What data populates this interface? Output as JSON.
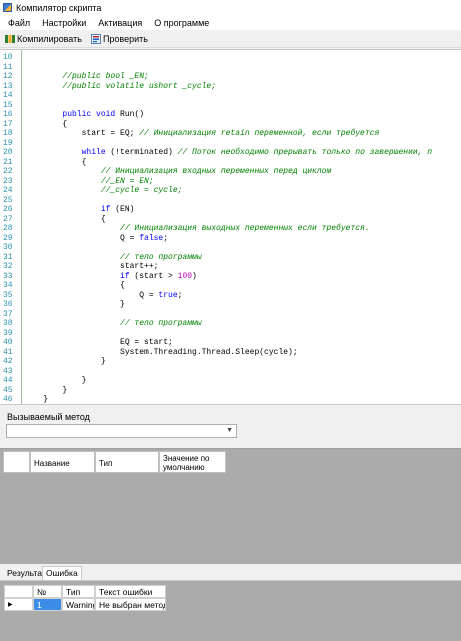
{
  "window": {
    "title": "Компилятор скрипта"
  },
  "menu": [
    "Файл",
    "Настройки",
    "Активация",
    "О программе"
  ],
  "toolbar": {
    "compile_label": "Компилировать",
    "check_label": "Проверить"
  },
  "code_lines": [
    {
      "n": "10",
      "segs": []
    },
    {
      "n": "11",
      "segs": []
    },
    {
      "n": "12",
      "segs": [
        {
          "t": "        "
        },
        {
          "t": "//public bool _EN;",
          "c": "cmt"
        }
      ]
    },
    {
      "n": "13",
      "segs": [
        {
          "t": "        "
        },
        {
          "t": "//public volatile ushort _cycle;",
          "c": "cmt"
        }
      ]
    },
    {
      "n": "14",
      "segs": []
    },
    {
      "n": "15",
      "segs": []
    },
    {
      "n": "16",
      "segs": [
        {
          "t": "        "
        },
        {
          "t": "public",
          "c": "kw"
        },
        {
          "t": " "
        },
        {
          "t": "void",
          "c": "kw"
        },
        {
          "t": " Run()"
        }
      ]
    },
    {
      "n": "17",
      "segs": [
        {
          "t": "        {"
        }
      ]
    },
    {
      "n": "18",
      "segs": [
        {
          "t": "            start = EQ; "
        },
        {
          "t": "// Инициализация retain переменной, если требуется",
          "c": "cmt"
        }
      ]
    },
    {
      "n": "19",
      "segs": []
    },
    {
      "n": "20",
      "segs": [
        {
          "t": "            "
        },
        {
          "t": "while",
          "c": "kw"
        },
        {
          "t": " (!terminated) "
        },
        {
          "t": "// Поток необходимо прерывать только по завершении, п",
          "c": "cmt"
        }
      ]
    },
    {
      "n": "21",
      "segs": [
        {
          "t": "            {"
        }
      ]
    },
    {
      "n": "22",
      "segs": [
        {
          "t": "                "
        },
        {
          "t": "// Инициализация входных переменных перед циклом",
          "c": "cmt"
        }
      ]
    },
    {
      "n": "23",
      "segs": [
        {
          "t": "                "
        },
        {
          "t": "//_EN = EN;",
          "c": "cmt"
        }
      ]
    },
    {
      "n": "24",
      "segs": [
        {
          "t": "                "
        },
        {
          "t": "//_cycle = cycle;",
          "c": "cmt"
        }
      ]
    },
    {
      "n": "25",
      "segs": []
    },
    {
      "n": "26",
      "segs": [
        {
          "t": "                "
        },
        {
          "t": "if",
          "c": "kw"
        },
        {
          "t": " (EN)"
        }
      ]
    },
    {
      "n": "27",
      "segs": [
        {
          "t": "                {"
        }
      ]
    },
    {
      "n": "28",
      "segs": [
        {
          "t": "                    "
        },
        {
          "t": "// Инициализация выходных переменных если требуется.",
          "c": "cmt"
        }
      ]
    },
    {
      "n": "29",
      "segs": [
        {
          "t": "                    Q = "
        },
        {
          "t": "false",
          "c": "kw"
        },
        {
          "t": ";"
        }
      ]
    },
    {
      "n": "30",
      "segs": []
    },
    {
      "n": "31",
      "segs": [
        {
          "t": "                    "
        },
        {
          "t": "// тело программы",
          "c": "cmt"
        }
      ]
    },
    {
      "n": "32",
      "segs": [
        {
          "t": "                    start++;"
        }
      ]
    },
    {
      "n": "33",
      "segs": [
        {
          "t": "                    "
        },
        {
          "t": "if",
          "c": "kw"
        },
        {
          "t": " (start > "
        },
        {
          "t": "100",
          "c": "num"
        },
        {
          "t": ")"
        }
      ]
    },
    {
      "n": "34",
      "segs": [
        {
          "t": "                    {"
        }
      ]
    },
    {
      "n": "35",
      "segs": [
        {
          "t": "                        Q = "
        },
        {
          "t": "true",
          "c": "kw"
        },
        {
          "t": ";"
        }
      ]
    },
    {
      "n": "36",
      "segs": [
        {
          "t": "                    }"
        }
      ]
    },
    {
      "n": "37",
      "segs": []
    },
    {
      "n": "38",
      "segs": [
        {
          "t": "                    "
        },
        {
          "t": "// тело программы",
          "c": "cmt"
        }
      ]
    },
    {
      "n": "39",
      "segs": []
    },
    {
      "n": "40",
      "segs": [
        {
          "t": "                    EQ = start;"
        }
      ]
    },
    {
      "n": "41",
      "segs": [
        {
          "t": "                    System.Threading.Thread.Sleep(cycle);"
        }
      ]
    },
    {
      "n": "42",
      "segs": [
        {
          "t": "                }"
        }
      ]
    },
    {
      "n": "43",
      "segs": []
    },
    {
      "n": "44",
      "segs": [
        {
          "t": "            }"
        }
      ]
    },
    {
      "n": "45",
      "segs": [
        {
          "t": "        }"
        }
      ]
    },
    {
      "n": "46",
      "segs": [
        {
          "t": "    }"
        }
      ]
    }
  ],
  "method": {
    "label": "Вызываемый метод",
    "value": ""
  },
  "params_table": {
    "columns": [
      "Название",
      "Тип",
      "Значение по умолчанию"
    ]
  },
  "bottom_tabs": [
    "Результат",
    "Ошибка"
  ],
  "errors_table": {
    "columns": [
      "№",
      "Тип",
      "Текст ошибки"
    ],
    "rows": [
      {
        "num": "1",
        "type": "Warning",
        "text": "Не выбран метод!"
      }
    ]
  }
}
